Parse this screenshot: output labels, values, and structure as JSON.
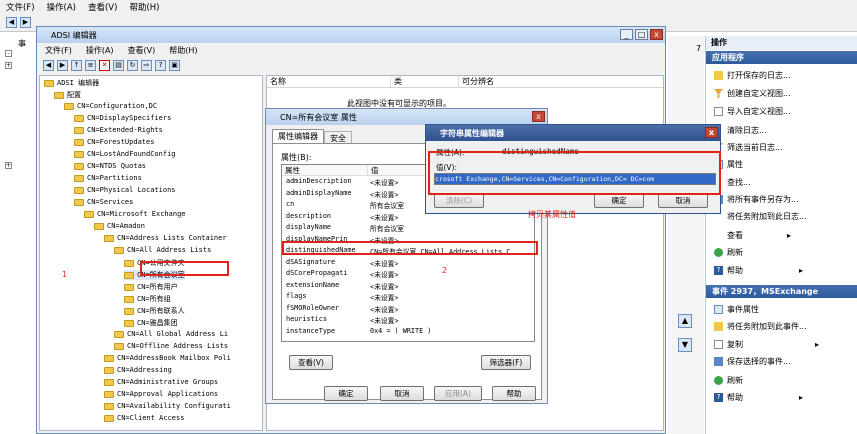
{
  "main_menu": [
    "文件(F)",
    "操作(A)",
    "查看(V)",
    "帮助(H)"
  ],
  "mmc_console": {
    "tree_label": "事"
  },
  "adsi": {
    "title": "ADSI 编辑器",
    "menu": [
      "文件(F)",
      "操作(A)",
      "查看(V)",
      "帮助(H)"
    ],
    "tree": [
      {
        "label": "ADSI 编辑器",
        "level": 0
      },
      {
        "label": "配置",
        "level": 1
      },
      {
        "label": "CN=Configuration,DC",
        "level": 2
      },
      {
        "label": "CN=DisplaySpecifiers",
        "level": 3
      },
      {
        "label": "CN=Extended-Rights",
        "level": 3
      },
      {
        "label": "CN=ForestUpdates",
        "level": 3
      },
      {
        "label": "CN=LostAndFoundConfig",
        "level": 3
      },
      {
        "label": "CN=NTDS Quotas",
        "level": 3
      },
      {
        "label": "CN=Partitions",
        "level": 3
      },
      {
        "label": "CN=Physical Locations",
        "level": 3
      },
      {
        "label": "CN=Services",
        "level": 3
      },
      {
        "label": "CN=Microsoft Exchange",
        "level": 4
      },
      {
        "label": "CN=Amadon",
        "level": 5
      },
      {
        "label": "CN=Address Lists Container",
        "level": 6
      },
      {
        "label": "CN=All Address Lists",
        "level": 7
      },
      {
        "label": "CN=公用文件夹",
        "level": 8
      },
      {
        "label": "CN=所有会议室",
        "level": 8
      },
      {
        "label": "CN=所有用户",
        "level": 8
      },
      {
        "label": "CN=所有组",
        "level": 8
      },
      {
        "label": "CN=所有联系人",
        "level": 8
      },
      {
        "label": "CN=雅昌集团",
        "level": 8
      },
      {
        "label": "CN=All Global Address Li",
        "level": 7
      },
      {
        "label": "CN=Offline Address Lists",
        "level": 7
      },
      {
        "label": "CN=AddressBook Mailbox Poli",
        "level": 6
      },
      {
        "label": "CN=Addressing",
        "level": 6
      },
      {
        "label": "CN=Administrative Groups",
        "level": 6
      },
      {
        "label": "CN=Approval Applications",
        "level": 6
      },
      {
        "label": "CN=Availability Configurati",
        "level": 6
      },
      {
        "label": "CN=Client Access",
        "level": 6
      }
    ],
    "list_headers": [
      "名称",
      "类",
      "可分辨名"
    ],
    "empty_message": "此视图中没有可显示的项目。"
  },
  "props": {
    "title": "CN=所有会议室 属性",
    "tabs": [
      "属性编辑器",
      "安全"
    ],
    "attrs_label": "属性(B):",
    "col_attr": "属性",
    "col_value": "值",
    "rows": [
      [
        "adminDescription",
        "<未设置>"
      ],
      [
        "adminDisplayName",
        "<未设置>"
      ],
      [
        "cn",
        "所有会议室"
      ],
      [
        "description",
        "<未设置>"
      ],
      [
        "displayName",
        "所有会议室"
      ],
      [
        "displayNamePrin",
        "<未设置>"
      ],
      [
        "distinguishedName",
        "CN=所有会议室,CN=All Address Lists,C"
      ],
      [
        "dSASignature",
        "<未设置>"
      ],
      [
        "dSCorePropagati",
        "<未设置>"
      ],
      [
        "extensionName",
        "<未设置>"
      ],
      [
        "flags",
        "<未设置>"
      ],
      [
        "fSMORoleOwner",
        "<未设置>"
      ],
      [
        "heuristics",
        "<未设置>"
      ],
      [
        "instanceType",
        "0x4 = ( WRITE )"
      ]
    ],
    "view_btn": "查看(V)",
    "filter_btn": "筛选器(F)",
    "ok": "确定",
    "cancel": "取消",
    "apply": "应用(A)",
    "help": "帮助"
  },
  "string_editor": {
    "title": "字符串属性编辑器",
    "attr_label": "属性(A):",
    "attr_value": "distinguishedName",
    "value_label": "值(V):",
    "value": "crosoft Exchange,CN=Services,CN=Configuration,DC=          DC=com",
    "clear": "清除(C)",
    "ok": "确定",
    "cancel": "取消"
  },
  "annotations": {
    "one": "1",
    "two": "2",
    "copy_note": "拷贝其属性值"
  },
  "actions": {
    "header": "操作",
    "section1": "应用程序",
    "items1": [
      "打开保存的日志...",
      "创建自定义视图...",
      "导入自定义视图...",
      "清除日志...",
      "筛选当前日志...",
      "属性",
      "查找...",
      "将所有事件另存为...",
      "将任务附加到此日志...",
      "查看",
      "刷新",
      "帮助"
    ],
    "section2": "事件 2937，MSExchange",
    "items2": [
      "事件属性",
      "将任务附加到此事件...",
      "复制",
      "保存选择的事件...",
      "刷新",
      "帮助"
    ]
  },
  "partial_right": {
    "label": "7"
  }
}
